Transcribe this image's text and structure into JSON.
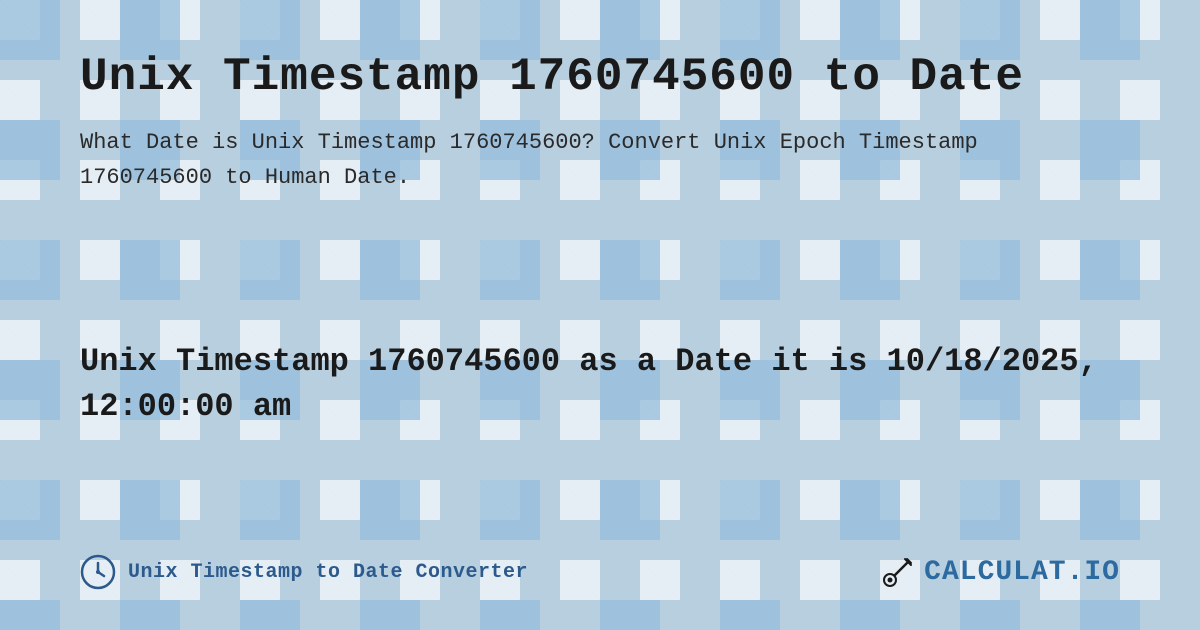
{
  "page": {
    "title": "Unix Timestamp 1760745600 to Date",
    "description": "What Date is Unix Timestamp 1760745600? Convert Unix Epoch Timestamp 1760745600 to Human Date.",
    "result": "Unix Timestamp 1760745600 as a Date it is 10/18/2025, 12:00:00 am",
    "footer_label": "Unix Timestamp to Date Converter",
    "logo_text": "CALCULAT.IO",
    "accent_color": "#2c5a8c"
  }
}
